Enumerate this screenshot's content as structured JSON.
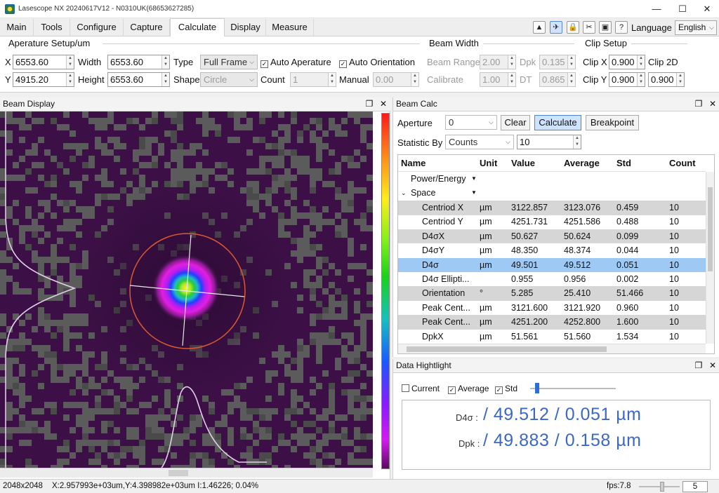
{
  "titlebar": {
    "title": "Lasescope NX 20240617V12 - N0310UK(68653627285)",
    "minimize": "—",
    "maximize": "☐",
    "close": "✕"
  },
  "menu": {
    "tabs": [
      "Main",
      "Tools",
      "Configure",
      "Capture",
      "Calculate",
      "Display",
      "Measure"
    ],
    "active_tab": "Calculate",
    "language_label": "Language",
    "language_value": "English"
  },
  "aperture_setup": {
    "title": "Aperature Setup/um",
    "x_label": "X",
    "x_value": "6553.60",
    "y_label": "Y",
    "y_value": "4915.20",
    "width_label": "Width",
    "width_value": "6553.60",
    "height_label": "Height",
    "height_value": "6553.60",
    "type_label": "Type",
    "type_value": "Full Frame",
    "shape_label": "Shape",
    "shape_value": "Circle",
    "auto_aperture_label": "Auto Aperature",
    "auto_aperture_checked": true,
    "auto_orientation_label": "Auto Orientation",
    "auto_orientation_checked": true,
    "count_label": "Count",
    "count_value": "1",
    "manual_label": "Manual",
    "manual_value": "0.00"
  },
  "beam_width": {
    "title": "Beam Width",
    "beam_range_label": "Beam Range",
    "beam_range_value": "2.00",
    "dpk_label": "Dpk",
    "dpk_value": "0.135",
    "calibrate_label": "Calibrate",
    "calibrate_value": "1.00",
    "dt_label": "DT",
    "dt_value": "0.865"
  },
  "clip_setup": {
    "title": "Clip Setup",
    "clip_x_label": "Clip X",
    "clip_x_value": "0.900",
    "clip_2d_label": "Clip 2D",
    "clip_y_label": "Clip Y",
    "clip_y_value": "0.900",
    "clip_2d_value": "0.900"
  },
  "beam_display": {
    "title": "Beam Display"
  },
  "beam_calc": {
    "title": "Beam Calc",
    "aperture_label": "Aperture",
    "aperture_value": "0",
    "clear_label": "Clear",
    "calculate_label": "Calculate",
    "breakpoint_label": "Breakpoint",
    "statistic_label": "Statistic By",
    "statistic_value": "Counts",
    "statistic_count": "10",
    "columns": [
      "Name",
      "Unit",
      "Value",
      "Average",
      "Std",
      "Count"
    ],
    "groups": {
      "power": "Power/Energy",
      "space": "Space"
    },
    "rows": [
      {
        "name": "Centriod X",
        "unit": "µm",
        "value": "3122.857",
        "average": "3123.076",
        "std": "0.459",
        "count": "10"
      },
      {
        "name": "Centriod Y",
        "unit": "µm",
        "value": "4251.731",
        "average": "4251.586",
        "std": "0.488",
        "count": "10"
      },
      {
        "name": "D4σX",
        "unit": "µm",
        "value": "50.627",
        "average": "50.624",
        "std": "0.099",
        "count": "10"
      },
      {
        "name": "D4σY",
        "unit": "µm",
        "value": "48.350",
        "average": "48.374",
        "std": "0.044",
        "count": "10"
      },
      {
        "name": "D4σ",
        "unit": "µm",
        "value": "49.501",
        "average": "49.512",
        "std": "0.051",
        "count": "10"
      },
      {
        "name": "D4σ Ellipti...",
        "unit": "",
        "value": "0.955",
        "average": "0.956",
        "std": "0.002",
        "count": "10"
      },
      {
        "name": "Orientation",
        "unit": "°",
        "value": "5.285",
        "average": "25.410",
        "std": "51.466",
        "count": "10"
      },
      {
        "name": "Peak Cent...",
        "unit": "µm",
        "value": "3121.600",
        "average": "3121.920",
        "std": "0.960",
        "count": "10"
      },
      {
        "name": "Peak Cent...",
        "unit": "µm",
        "value": "4251.200",
        "average": "4252.800",
        "std": "1.600",
        "count": "10"
      },
      {
        "name": "DpkX",
        "unit": "µm",
        "value": "51.561",
        "average": "51.560",
        "std": "1.534",
        "count": "10"
      }
    ]
  },
  "data_highlight": {
    "title": "Data Hightlight",
    "current_label": "Current",
    "current_checked": false,
    "average_label": "Average",
    "average_checked": true,
    "std_label": "Std",
    "std_checked": true,
    "d4s_label": "D4σ :",
    "d4s_value": "/ 49.512  / 0.051 µm",
    "dpk_label": "Dpk :",
    "dpk_value": "/ 49.883  / 0.158 µm"
  },
  "status": {
    "resolution": "2048x2048",
    "cursor": "X:2.957993e+03um,Y:4.398982e+03um I:1.46226; 0.04%",
    "fps": "fps:7.8",
    "rate": "5"
  },
  "colors": {
    "accent": "#3a68c8",
    "selection": "#9ec9f5",
    "beam_background": "#3c1046"
  }
}
